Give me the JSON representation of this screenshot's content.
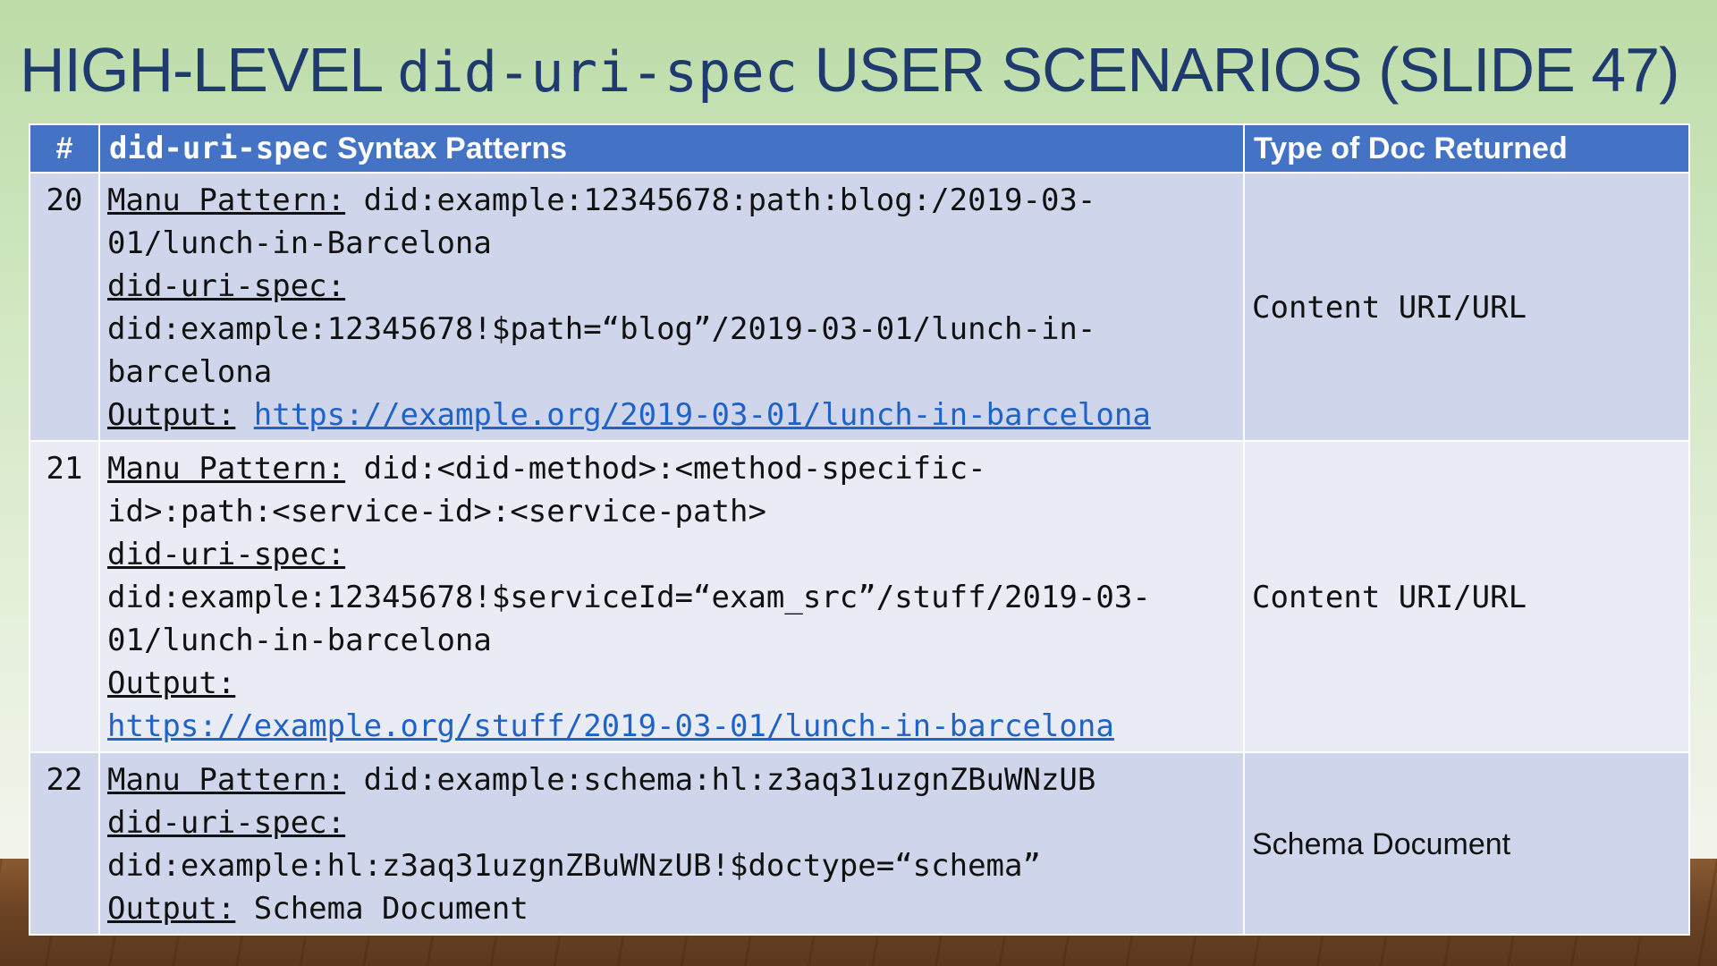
{
  "slide": {
    "title_prefix": "HIGH-LEVEL ",
    "title_code": "did-uri-spec",
    "title_suffix": " USER SCENARIOS (SLIDE 47)"
  },
  "table": {
    "headers": {
      "number": "#",
      "pattern_code": "did-uri-spec",
      "pattern_rest": " Syntax Patterns",
      "doc_type": "Type of Doc Returned"
    },
    "rows": [
      {
        "number": "20",
        "manu_label": "Manu Pattern:",
        "manu_line1": " did:example:12345678:path:blog:/2019-03-",
        "manu_line2": "01/lunch-in-Barcelona",
        "spec_label": "did-uri-spec:",
        "spec_line1": "did:example:12345678!$path=“blog”/2019-03-01/lunch-in-",
        "spec_line2": "barcelona",
        "output_label": "Output:",
        "output_value": "https://example.org/2019-03-01/lunch-in-barcelona",
        "doc_type": "Content URI/URL"
      },
      {
        "number": "21",
        "manu_label": "Manu Pattern:",
        "manu_line1": " did:<did-method>:<method-specific-",
        "manu_line2": "id>:path:<service-id>:<service-path>",
        "spec_label": "did-uri-spec:",
        "spec_line1": "did:example:12345678!$serviceId=“exam_src”/stuff/2019-03-",
        "spec_line2": "01/lunch-in-barcelona",
        "output_label": "Output:",
        "output_value": "https://example.org/stuff/2019-03-01/lunch-in-barcelona",
        "doc_type": "Content URI/URL"
      },
      {
        "number": "22",
        "manu_label": "Manu Pattern:",
        "manu_line1": " did:example:schema:hl:z3aq31uzgnZBuWNzUB",
        "spec_label": "did-uri-spec:",
        "spec_line1": "did:example:hl:z3aq31uzgnZBuWNzUB!$doctype=“schema”",
        "output_label": "Output:",
        "output_value": " Schema Document",
        "doc_type": "Schema Document"
      }
    ]
  }
}
